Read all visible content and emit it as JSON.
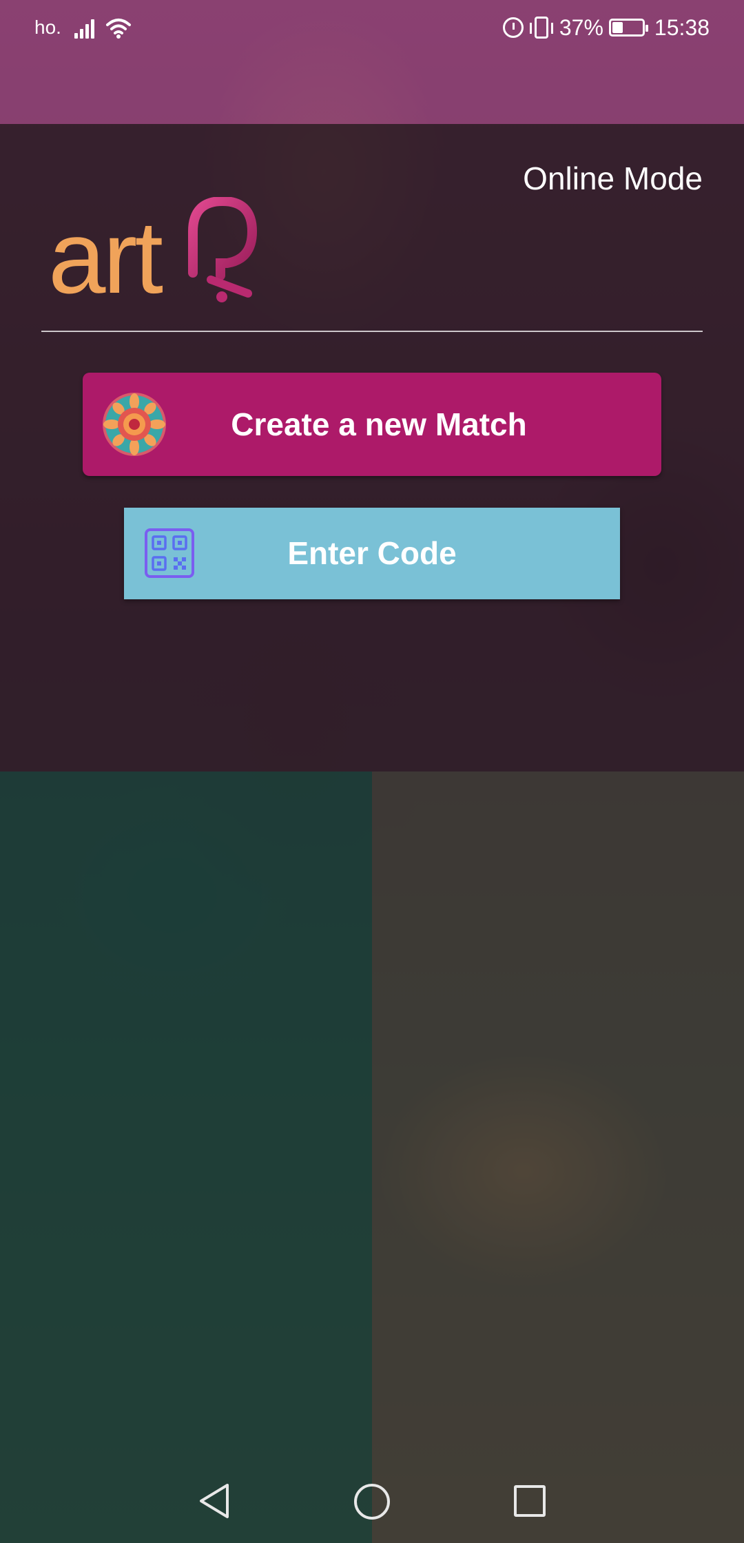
{
  "status_bar": {
    "carrier": "ho.",
    "battery_percent": "37%",
    "battery_level": 0.37,
    "time": "15:38",
    "icons": [
      "signal-icon",
      "wifi-icon",
      "alarm-icon",
      "vibrate-icon",
      "battery-icon"
    ]
  },
  "header": {
    "mode_label": "Online Mode",
    "logo_text": "art",
    "logo_mark": "Q?"
  },
  "buttons": {
    "create_match": "Create a new Match",
    "enter_code": "Enter Code"
  },
  "colors": {
    "create_button": "#ad1a69",
    "enter_code_button": "#7ac1d6",
    "logo_art": "#f0a35a",
    "logo_q": "#d23a86"
  },
  "nav_bar": {
    "icons": [
      "back-icon",
      "home-icon",
      "recent-apps-icon"
    ]
  }
}
